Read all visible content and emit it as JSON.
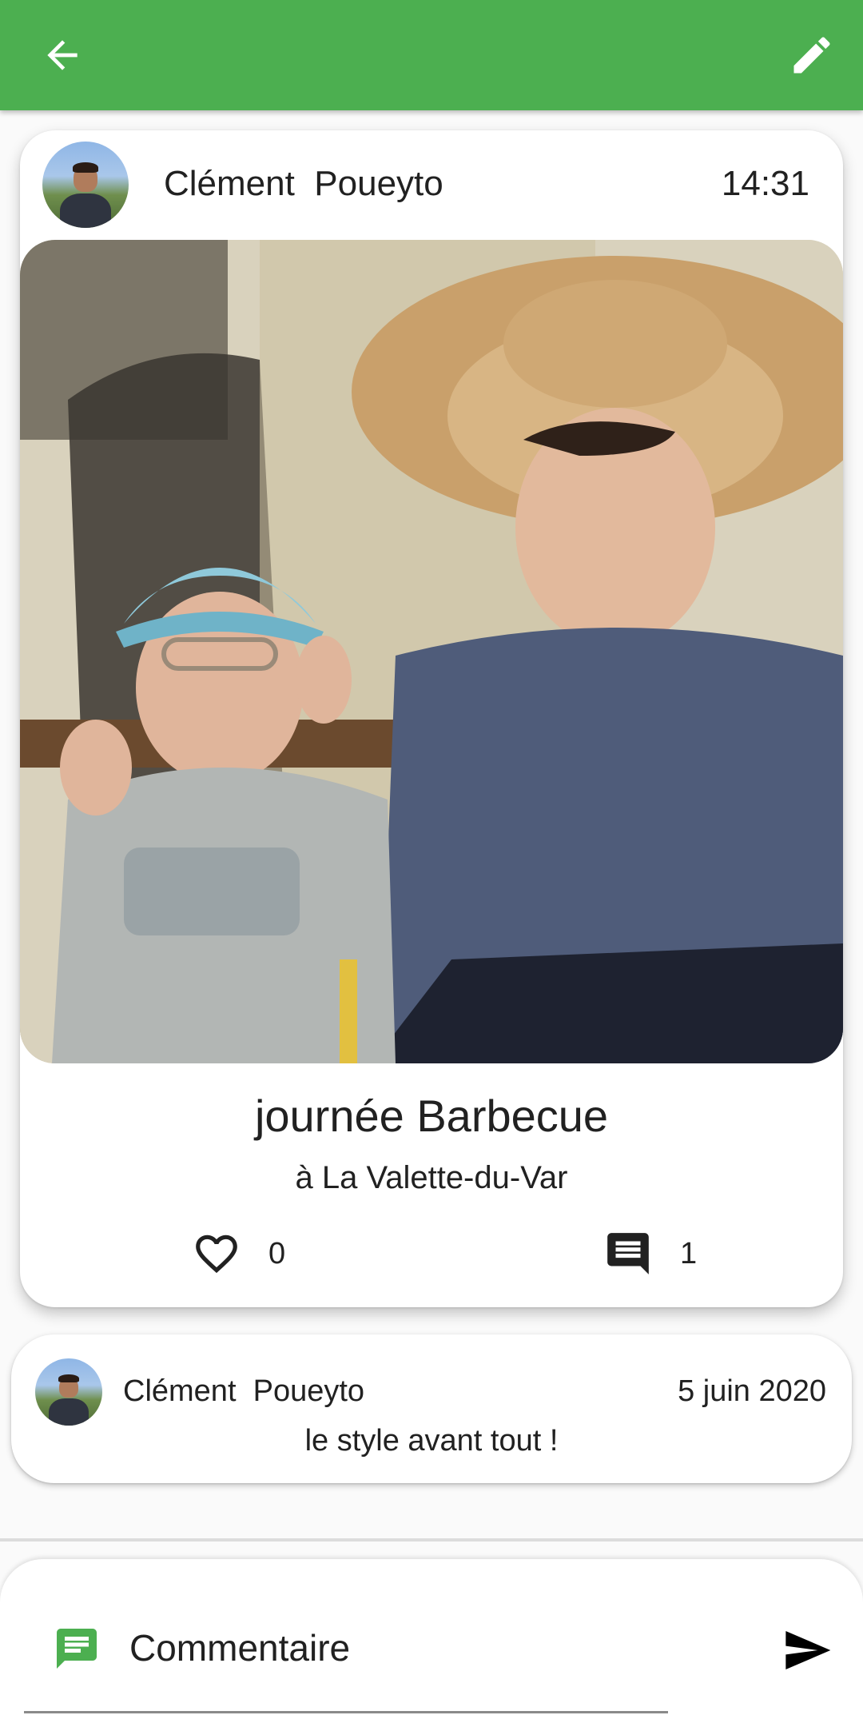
{
  "appbar": {
    "color": "#4caf50",
    "back_icon": "arrow-back-icon",
    "edit_icon": "pencil-edit-icon"
  },
  "post": {
    "author": "Clément  Poueyto",
    "time": "14:31",
    "title": "journée Barbecue",
    "location": "à La Valette-du-Var",
    "likes": "0",
    "comments_count": "1",
    "like_icon": "heart-outline-icon",
    "comment_icon": "comment-icon"
  },
  "comment": {
    "author": "Clément  Poueyto",
    "date": "5 juin 2020",
    "text": "le style avant tout !"
  },
  "composer": {
    "placeholder": "Commentaire",
    "icon": "message-icon",
    "icon_color": "#4caf50",
    "send_icon": "send-icon"
  }
}
